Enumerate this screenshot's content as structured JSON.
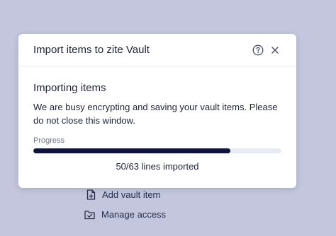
{
  "backdrop": {
    "items": [
      {
        "label": "Add vault item",
        "icon": "file-plus-icon"
      },
      {
        "label": "Manage access",
        "icon": "folder-check-icon"
      }
    ]
  },
  "dialog": {
    "title": "Import items to zite Vault",
    "help_icon": "help-circle-icon",
    "close_icon": "close-icon",
    "heading": "Importing items",
    "description": "We are busy encrypting and saving your vault items. Please do not close this window.",
    "progress": {
      "label": "Progress",
      "current": 50,
      "total": 63,
      "status_text": "50/63 lines imported"
    }
  },
  "colors": {
    "backdrop": "#c3c6dd",
    "progress_fill": "#0e1342",
    "progress_track": "#e8ebf6",
    "text": "#1e2140"
  }
}
